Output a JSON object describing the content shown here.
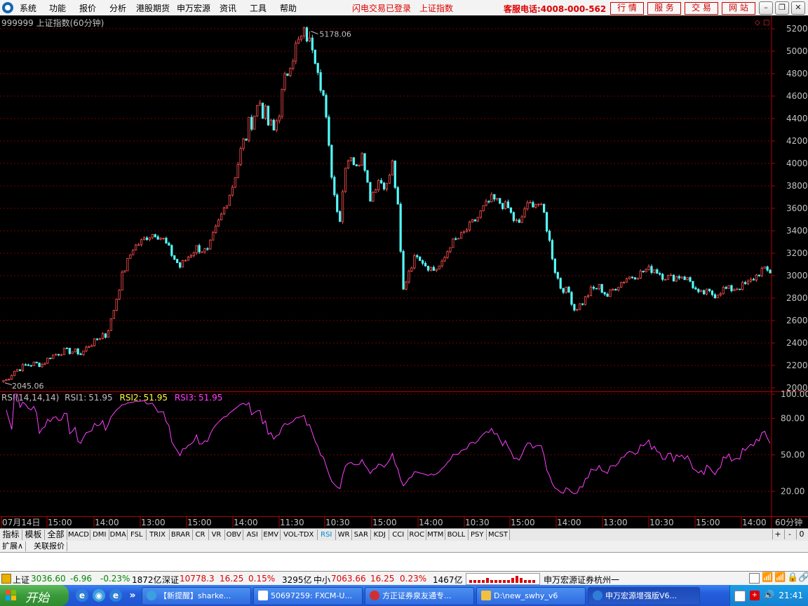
{
  "menu": {
    "items": [
      "系统",
      "功能",
      "报价",
      "分析",
      "港股期货",
      "申万宏源",
      "资讯",
      "工具",
      "帮助"
    ],
    "notice1": "闪电交易已登录",
    "notice2": "上证指数",
    "hotline": "客服电话:4008-000-562",
    "buttons": [
      "行 情",
      "服 务",
      "交 易",
      "网 站"
    ]
  },
  "chart": {
    "title": "999999 上证指数(60分钟)",
    "high_label": "5178.06",
    "low_label": "2045.06",
    "price_axis": [
      "5200",
      "5000",
      "4800",
      "4600",
      "4400",
      "4200",
      "4000",
      "3800",
      "3600",
      "3400",
      "3200",
      "3000",
      "2800",
      "2600",
      "2400",
      "2200",
      "2000"
    ],
    "rsi": {
      "name": "RSI(14,14,14)",
      "rsi1_label": "RSI1:",
      "rsi1_value": "51.95",
      "rsi2_label": "RSI2:",
      "rsi2_value": "51.95",
      "rsi3_label": "RSI3:",
      "rsi3_value": "51.95",
      "axis": [
        "100.00",
        "80.00",
        "50.00",
        "20.00"
      ]
    },
    "time_axis": [
      "07月14日",
      "15:00",
      "14:00",
      "13:00",
      "15:00",
      "14:00",
      "11:30",
      "10:30",
      "15:00",
      "14:00",
      "10:30",
      "15:00",
      "14:00",
      "13:00",
      "10:30",
      "15:00",
      "14:00"
    ],
    "period": "60分钟",
    "colors": {
      "up": "#ff5050",
      "down": "#54fcfc",
      "rsi": "#ff40ff",
      "grid": "#7a0000"
    }
  },
  "chart_data": {
    "type": "candlestick",
    "title": "999999 上证指数(60分钟)",
    "ylim": [
      2000,
      5200
    ],
    "anchor_points": [
      [
        0,
        2045
      ],
      [
        4,
        2150
      ],
      [
        8,
        2200
      ],
      [
        11,
        2215
      ],
      [
        14,
        2210
      ],
      [
        17,
        2280
      ],
      [
        22,
        2330
      ],
      [
        27,
        2320
      ],
      [
        28,
        2300
      ],
      [
        31,
        2380
      ],
      [
        33,
        2410
      ],
      [
        36,
        2480
      ],
      [
        37,
        2460
      ],
      [
        39,
        2600
      ],
      [
        43,
        3000
      ],
      [
        47,
        3250
      ],
      [
        50,
        3300
      ],
      [
        52,
        3350
      ],
      [
        55,
        3380
      ],
      [
        58,
        3320
      ],
      [
        62,
        3150
      ],
      [
        64,
        3080
      ],
      [
        67,
        3170
      ],
      [
        70,
        3250
      ],
      [
        74,
        3210
      ],
      [
        76,
        3350
      ],
      [
        80,
        3600
      ],
      [
        83,
        3800
      ],
      [
        86,
        4100
      ],
      [
        90,
        4400
      ],
      [
        93,
        4550
      ],
      [
        96,
        4350
      ],
      [
        98,
        4280
      ],
      [
        101,
        4600
      ],
      [
        104,
        4950
      ],
      [
        108,
        5100
      ],
      [
        111,
        5178
      ],
      [
        114,
        4900
      ],
      [
        116,
        4600
      ],
      [
        118,
        4100
      ],
      [
        120,
        3720
      ],
      [
        122,
        3500
      ],
      [
        124,
        4000
      ],
      [
        126,
        4100
      ],
      [
        128,
        3950
      ],
      [
        130,
        4150
      ],
      [
        132,
        3820
      ],
      [
        133,
        3700
      ],
      [
        136,
        3850
      ],
      [
        139,
        3800
      ],
      [
        141,
        4000
      ],
      [
        143,
        3600
      ],
      [
        144,
        3200
      ],
      [
        145,
        2870
      ],
      [
        147,
        3050
      ],
      [
        150,
        3200
      ],
      [
        153,
        3100
      ],
      [
        156,
        3050
      ],
      [
        159,
        3100
      ],
      [
        162,
        3280
      ],
      [
        166,
        3350
      ],
      [
        169,
        3440
      ],
      [
        172,
        3520
      ],
      [
        174,
        3600
      ],
      [
        177,
        3680
      ],
      [
        180,
        3650
      ],
      [
        183,
        3600
      ],
      [
        185,
        3500
      ],
      [
        187,
        3450
      ],
      [
        189,
        3600
      ],
      [
        192,
        3650
      ],
      [
        194,
        3640
      ],
      [
        196,
        3550
      ],
      [
        198,
        3300
      ],
      [
        200,
        3050
      ],
      [
        202,
        2900
      ],
      [
        205,
        2850
      ],
      [
        207,
        2700
      ],
      [
        210,
        2760
      ],
      [
        213,
        2870
      ],
      [
        216,
        2900
      ],
      [
        219,
        2820
      ],
      [
        222,
        2900
      ],
      [
        226,
        2980
      ],
      [
        230,
        3010
      ],
      [
        233,
        3050
      ],
      [
        236,
        3060
      ],
      [
        239,
        3000
      ],
      [
        242,
        2980
      ],
      [
        246,
        3000
      ],
      [
        249,
        2950
      ],
      [
        252,
        2830
      ],
      [
        255,
        2850
      ],
      [
        258,
        2830
      ],
      [
        261,
        2880
      ],
      [
        264,
        2880
      ],
      [
        267,
        2900
      ],
      [
        270,
        2930
      ],
      [
        273,
        3000
      ],
      [
        275,
        3050
      ],
      [
        278,
        3036
      ]
    ],
    "high": 5178.06,
    "low": 2045.06,
    "rsi_ylim": [
      0,
      100
    ],
    "rsi_last": 51.95
  },
  "tabs": [
    "指标",
    "模板",
    "全部",
    "MACD",
    "DMI",
    "DMA",
    "FSL",
    "TRIX",
    "BRAR",
    "CR",
    "VR",
    "OBV",
    "ASI",
    "EMV",
    "VOL-TDX",
    "RSI",
    "WR",
    "SAR",
    "KDJ",
    "CCI",
    "ROC",
    "MTM",
    "BOLL",
    "PSY",
    "MCST"
  ],
  "active_tab": "RSI",
  "tab_controls": [
    "+",
    "-",
    "0"
  ],
  "ext_tabs": [
    "扩展∧",
    "关联报价"
  ],
  "status": {
    "sh_label": "上证",
    "sh_value": "3036.60",
    "sh_change": "-6.96",
    "sh_pct": "-0.23%",
    "sh_amount": "1872亿",
    "sz_label": "深证",
    "sz_value": "10778.3",
    "sz_change": "16.25",
    "sz_pct": "0.15%",
    "sz_amount": "3295亿",
    "zx_label": "中小",
    "zx_value": "7063.66",
    "zx_change": "16.25",
    "zx_pct": "0.23%",
    "zx_amount": "1467亿",
    "broker": "申万宏源证券杭州一"
  },
  "taskbar": {
    "start": "开始",
    "tasks": [
      "【新提醒】sharke...",
      "50697259: FXCM-U...",
      "方正证券泉友通专...",
      "D:\\new_swhy_v6",
      "申万宏源增强版V6..."
    ],
    "clock": "21:41"
  }
}
